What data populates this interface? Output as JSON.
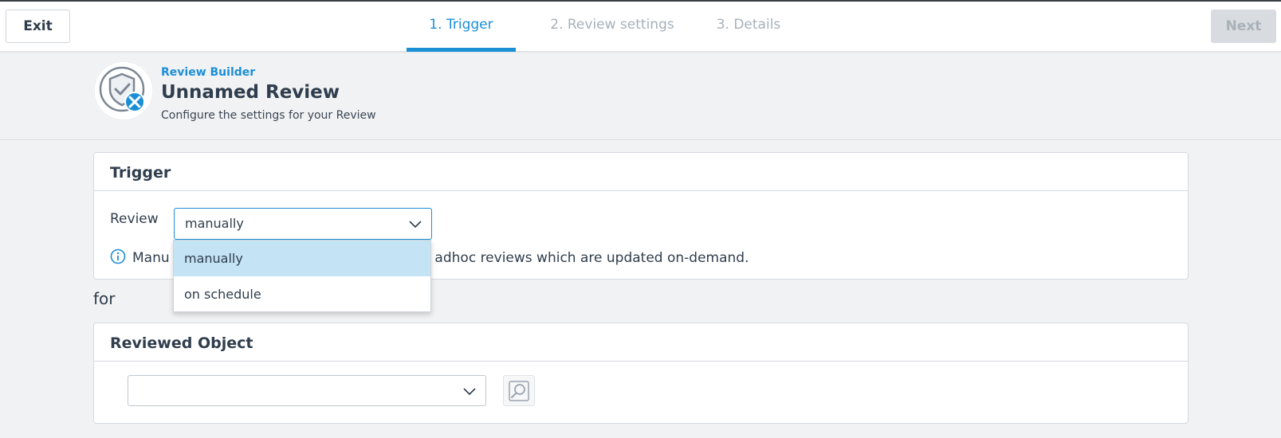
{
  "topbar": {
    "exit_label": "Exit",
    "next_label": "Next",
    "steps": [
      {
        "label": "1. Trigger",
        "active": true
      },
      {
        "label": "2. Review settings",
        "active": false
      },
      {
        "label": "3. Details",
        "active": false
      }
    ]
  },
  "header": {
    "breadcrumb": "Review Builder",
    "title": "Unnamed Review",
    "subtitle": "Configure the settings for your Review",
    "icon": "shield-check-tools-icon"
  },
  "trigger": {
    "title": "Trigger",
    "review_label": "Review",
    "selected_value": "manually",
    "info_visible_start": "Manu",
    "info_visible_end": "or adhoc reviews which are updated on-demand.",
    "dropdown_options": [
      {
        "label": "manually",
        "selected": true
      },
      {
        "label": "on schedule",
        "selected": false
      }
    ]
  },
  "for_label": "for",
  "reviewed_object": {
    "title": "Reviewed Object",
    "selected_value": "",
    "lookup_icon": "search-lookup-icon"
  },
  "colors": {
    "accent": "#1a8fd6",
    "selected_option_bg": "#c4e3f5",
    "disabled_button_bg": "#d8dce0"
  }
}
